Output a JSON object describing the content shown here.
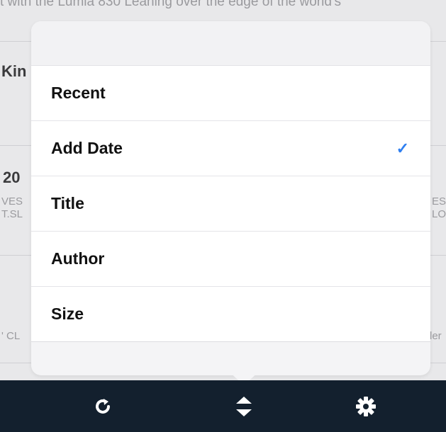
{
  "background": {
    "top_text": "t with the Lumia 830 Leaning over the edge of the world's",
    "row1_title_fragment": "Kin",
    "row2_title_fragment": "20",
    "row2_left_fragment_1": "VES",
    "row2_left_fragment_2": "T.SL",
    "row2_right_fragment_1": "ES",
    "row2_right_fragment_2": "LO",
    "row3_left_fragment": "' CL",
    "row3_right_fragment": "ler"
  },
  "sort_menu": {
    "items": [
      {
        "label": "Recent",
        "selected": false
      },
      {
        "label": "Add Date",
        "selected": true
      },
      {
        "label": "Title",
        "selected": false
      },
      {
        "label": "Author",
        "selected": false
      },
      {
        "label": "Size",
        "selected": false
      }
    ],
    "check_glyph": "✓",
    "accent_color": "#2f7ff0"
  },
  "toolbar": {
    "refresh_icon": "refresh-icon",
    "sort_icon": "sort-icon",
    "settings_icon": "gear-icon",
    "background_color": "#13202e"
  }
}
